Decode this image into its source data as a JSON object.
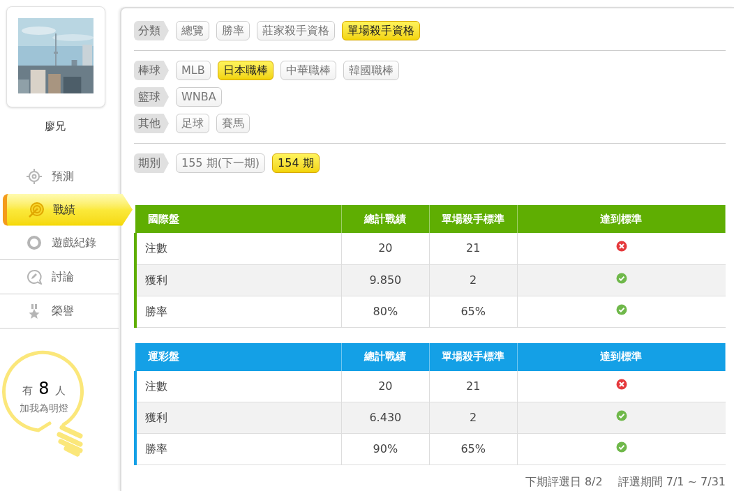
{
  "profile": {
    "name": "廖兄"
  },
  "nav": [
    {
      "label": "預測",
      "kind": "crosshair",
      "selected": false
    },
    {
      "label": "戰績",
      "kind": "target",
      "selected": true
    },
    {
      "label": "遊戲紀錄",
      "kind": "ring",
      "selected": false
    },
    {
      "label": "討論",
      "kind": "chat",
      "selected": false
    },
    {
      "label": "榮譽",
      "kind": "medal",
      "selected": false
    }
  ],
  "fans": {
    "prefix": "有",
    "count": "8",
    "suffix": "人",
    "caption": "加我為明燈"
  },
  "filter_groups": [
    [
      {
        "label": "分類",
        "options": [
          {
            "label": "總覽",
            "selected": false
          },
          {
            "label": "勝率",
            "selected": false
          },
          {
            "label": "莊家殺手資格",
            "selected": false
          },
          {
            "label": "單場殺手資格",
            "selected": true
          }
        ]
      }
    ],
    [
      {
        "label": "棒球",
        "options": [
          {
            "label": "MLB",
            "selected": false
          },
          {
            "label": "日本職棒",
            "selected": true
          },
          {
            "label": "中華職棒",
            "selected": false
          },
          {
            "label": "韓國職棒",
            "selected": false
          }
        ]
      },
      {
        "label": "籃球",
        "options": [
          {
            "label": "WNBA",
            "selected": false
          }
        ]
      },
      {
        "label": "其他",
        "options": [
          {
            "label": "足球",
            "selected": false
          },
          {
            "label": "賽馬",
            "selected": false
          }
        ]
      }
    ],
    [
      {
        "label": "期別",
        "options": [
          {
            "label": "155 期(下一期)",
            "selected": false
          },
          {
            "label": "154 期",
            "selected": true
          }
        ]
      }
    ]
  ],
  "tables": [
    {
      "color": "#5fae02",
      "columns": [
        "國際盤",
        "總計戰績",
        "單場殺手標準",
        "達到標準"
      ],
      "rows": [
        {
          "cells": [
            "注數",
            "20",
            "21"
          ],
          "met": false
        },
        {
          "cells": [
            "獲利",
            "9.850",
            "2"
          ],
          "met": true
        },
        {
          "cells": [
            "勝率",
            "80%",
            "65%"
          ],
          "met": true
        }
      ]
    },
    {
      "color": "#14a0e6",
      "columns": [
        "運彩盤",
        "總計戰績",
        "單場殺手標準",
        "達到標準"
      ],
      "rows": [
        {
          "cells": [
            "注數",
            "20",
            "21"
          ],
          "met": false
        },
        {
          "cells": [
            "獲利",
            "6.430",
            "2"
          ],
          "met": true
        },
        {
          "cells": [
            "勝率",
            "90%",
            "65%"
          ],
          "met": true
        }
      ]
    }
  ],
  "footer": [
    "下期評選日 8/2",
    "評選期間 7/1 ~ 7/31"
  ]
}
